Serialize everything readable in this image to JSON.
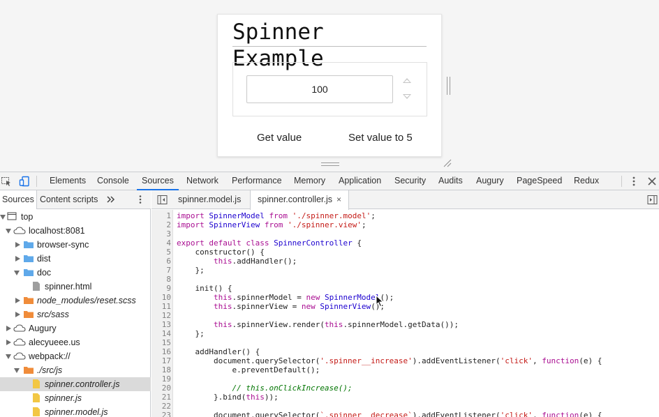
{
  "preview": {
    "title": "Spinner Example",
    "spinner_value": "100",
    "get_value_label": "Get value",
    "set_value_label": "Set value to 5"
  },
  "devtools": {
    "tabs": [
      "Elements",
      "Console",
      "Sources",
      "Network",
      "Performance",
      "Memory",
      "Application",
      "Security",
      "Audits",
      "Augury",
      "PageSpeed",
      "Redux"
    ],
    "active_tab": "Sources",
    "navigator_tabs": [
      "Sources",
      "Content scripts"
    ],
    "tree": [
      {
        "label": "top",
        "icon": "frame-icon"
      },
      {
        "label": "localhost:8081",
        "icon": "cloud-icon"
      },
      {
        "label": "browser-sync",
        "icon": "folder-icon"
      },
      {
        "label": "dist",
        "icon": "folder-icon"
      },
      {
        "label": "doc",
        "icon": "folder-icon"
      },
      {
        "label": "spinner.html",
        "icon": "file-icon"
      },
      {
        "label": "node_modules/reset.scss",
        "icon": "folder-icon"
      },
      {
        "label": "src/sass",
        "icon": "folder-icon"
      },
      {
        "label": "Augury",
        "icon": "cloud-icon"
      },
      {
        "label": "alecyueee.us",
        "icon": "cloud-icon"
      },
      {
        "label": "webpack://",
        "icon": "cloud-icon"
      },
      {
        "label": "./src/js",
        "icon": "folder-icon"
      },
      {
        "label": "spinner.controller.js",
        "icon": "js-file-icon"
      },
      {
        "label": "spinner.js",
        "icon": "js-file-icon"
      },
      {
        "label": "spinner.model.js",
        "icon": "js-file-icon"
      }
    ],
    "editor_tabs": [
      "spinner.model.js",
      "spinner.controller.js"
    ],
    "active_editor_tab": "spinner.controller.js",
    "code_lines": [
      "import SpinnerModel from './spinner.model';",
      "import SpinnerView from './spinner.view';",
      "",
      "export default class SpinnerController {",
      "    constructor() {",
      "        this.addHandler();",
      "    };",
      "",
      "    init() {",
      "        this.spinnerModel = new SpinnerModel();",
      "        this.spinnerView = new SpinnerView();",
      "",
      "        this.spinnerView.render(this.spinnerModel.getData());",
      "    };",
      "",
      "    addHandler() {",
      "        document.querySelector('.spinner__increase').addEventListener('click', function(e) {",
      "            e.preventDefault();",
      "",
      "            // this.onClickIncrease();",
      "        }.bind(this));",
      "",
      "        document.querySelector(`.spinner__decrease`).addEventListener('click', function(e) {"
    ],
    "line_numbers": [
      "1",
      "2",
      "3",
      "4",
      "5",
      "6",
      "7",
      "8",
      "9",
      "10",
      "11",
      "12",
      "13",
      "14",
      "15",
      "16",
      "17",
      "18",
      "19",
      "20",
      "21",
      "22",
      "23"
    ]
  },
  "colors": {
    "accent": "#1a73e8",
    "keyword": "#a90d91",
    "string": "#c41a16",
    "class": "#1c00cf",
    "comment": "#007400"
  }
}
